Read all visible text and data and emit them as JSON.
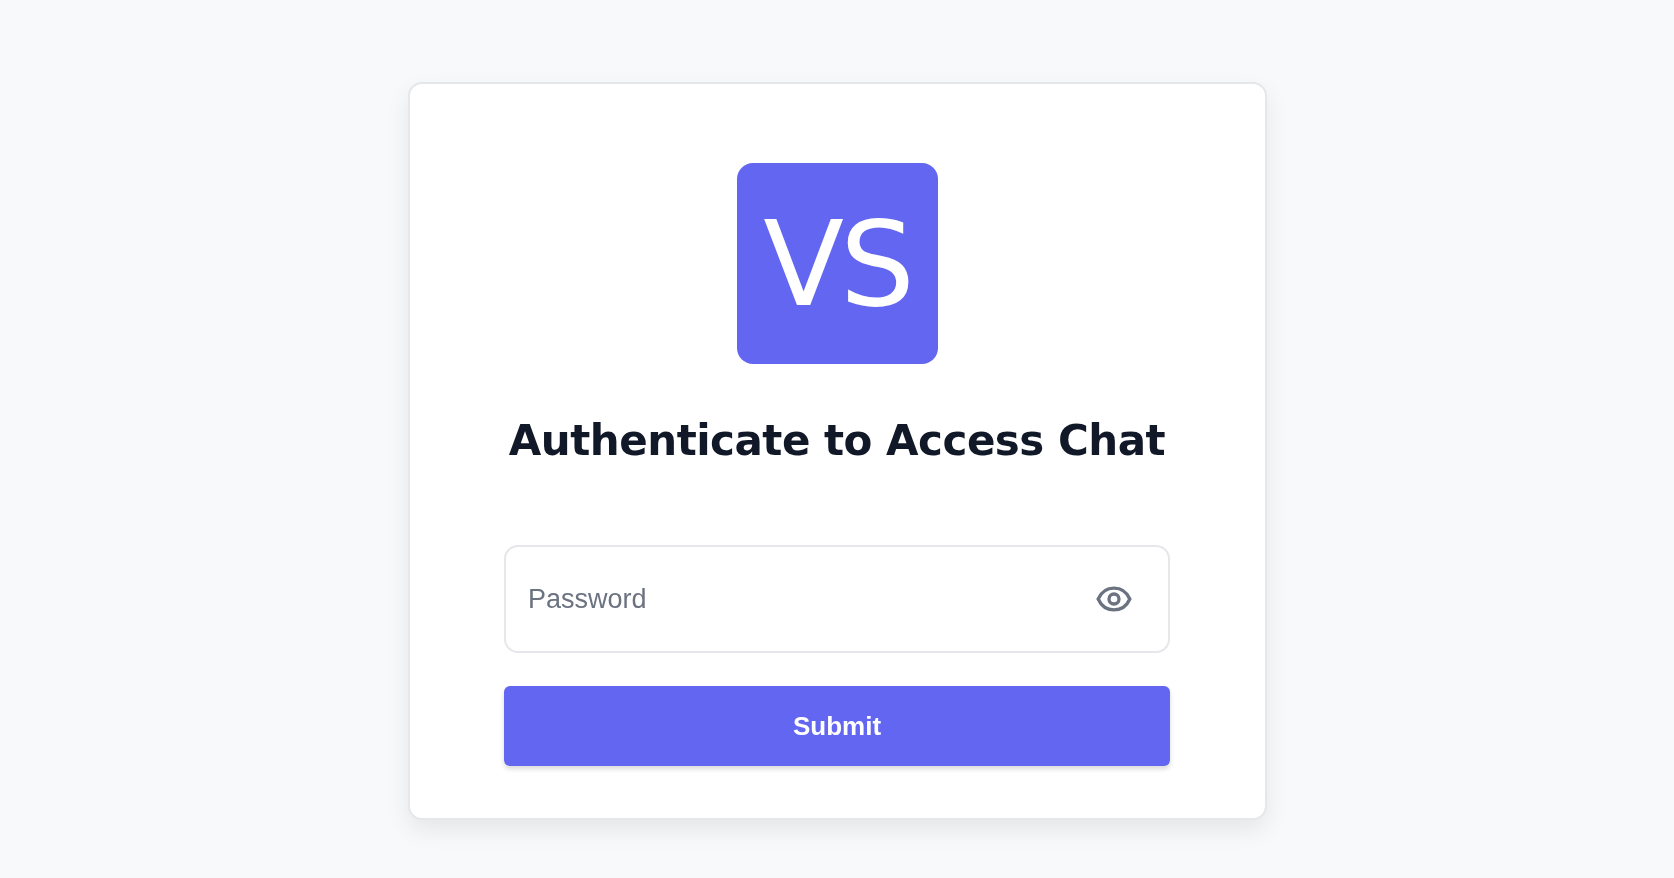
{
  "logo": {
    "text": "VS"
  },
  "title": "Authenticate to Access Chat",
  "password": {
    "placeholder": "Password"
  },
  "submit": {
    "label": "Submit"
  }
}
